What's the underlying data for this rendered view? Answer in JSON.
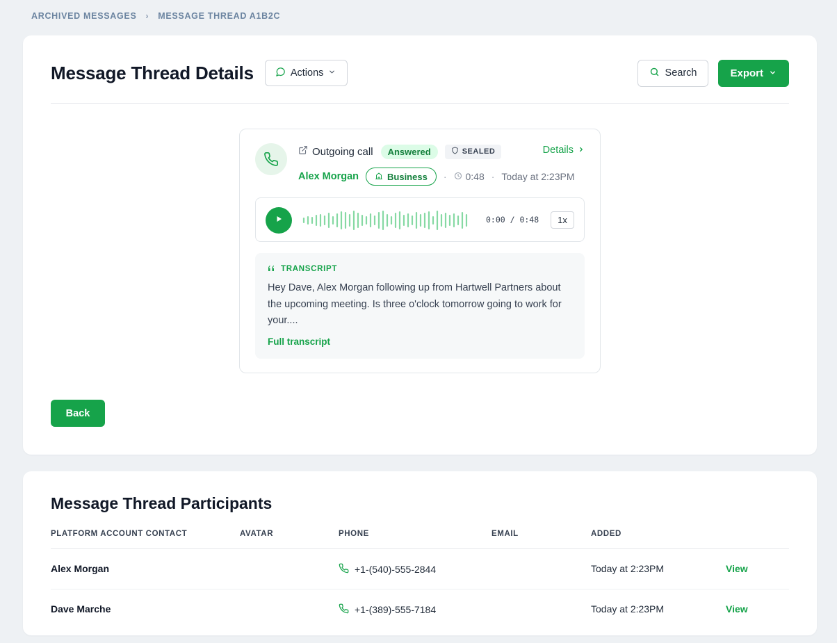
{
  "breadcrumb": {
    "items": [
      "ARCHIVED MESSAGES",
      "MESSAGE THREAD A1B2C"
    ],
    "separator": "›"
  },
  "header": {
    "title": "Message Thread Details",
    "actions_label": "Actions",
    "search_label": "Search",
    "export_label": "Export"
  },
  "call": {
    "type_label": "Outgoing call",
    "status_badge": "Answered",
    "sealed_badge": "SEALED",
    "details_link": "Details",
    "caller_name": "Alex Morgan",
    "category_badge": "Business",
    "duration": "0:48",
    "timestamp": "Today at 2:23PM",
    "separator": "·"
  },
  "player": {
    "time_readout": "0:00 / 0:48",
    "speed": "1x",
    "progress_fraction": 0
  },
  "transcript": {
    "heading": "TRANSCRIPT",
    "text": "Hey Dave, Alex Morgan following up from Hartwell Partners about the upcoming meeting. Is three o'clock tomorrow going to work for your....",
    "full_link": "Full transcript"
  },
  "back_label": "Back",
  "participants": {
    "title": "Message Thread Participants",
    "columns": [
      "PLATFORM ACCOUNT CONTACT",
      "AVATAR",
      "PHONE",
      "EMAIL",
      "ADDED"
    ],
    "rows": [
      {
        "name": "Alex Morgan",
        "phone": "+1-(540)-555-2844",
        "email": "",
        "added": "Today at 2:23PM",
        "action": "View"
      },
      {
        "name": "Dave Marche",
        "phone": "+1-(389)-555-7184",
        "email": "",
        "added": "Today at 2:23PM",
        "action": "View"
      }
    ]
  },
  "colors": {
    "accent": "#16a34a",
    "background": "#eef1f4",
    "card": "#ffffff",
    "breadcrumb": "#6b84a0",
    "waveform": "#86d9a3"
  },
  "icons": {
    "actions": "chat-bubble-icon",
    "search": "search-icon",
    "dropdown": "chevron-down-icon",
    "call": "phone-icon",
    "outgoing": "external-link-icon",
    "sealed": "shield-icon",
    "details": "chevron-right-icon",
    "business": "building-icon",
    "duration": "clock-icon",
    "play": "play-icon",
    "transcript": "quote-icon",
    "row_phone": "phone-icon"
  }
}
